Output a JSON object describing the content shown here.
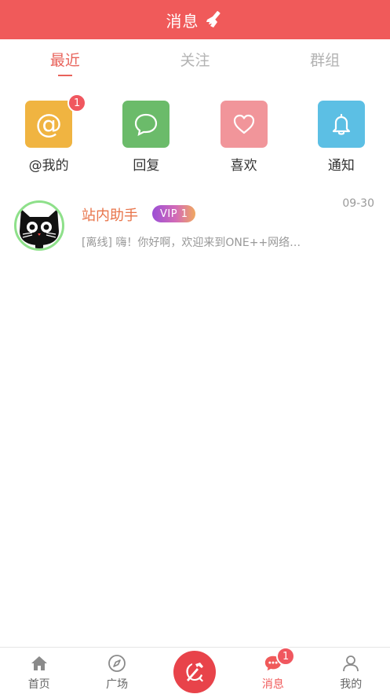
{
  "header": {
    "title": "消息",
    "icon": "broom-icon"
  },
  "tabs": [
    {
      "label": "最近",
      "active": true
    },
    {
      "label": "关注",
      "active": false
    },
    {
      "label": "群组",
      "active": false
    }
  ],
  "quick": [
    {
      "label": "@我的",
      "icon": "at-icon",
      "color": "#f0b441",
      "badge": "1"
    },
    {
      "label": "回复",
      "icon": "chat-bubble-icon",
      "color": "#6bbb6a"
    },
    {
      "label": "喜欢",
      "icon": "heart-icon",
      "color": "#f1959a"
    },
    {
      "label": "通知",
      "icon": "bell-icon",
      "color": "#5cbfe4"
    }
  ],
  "message": {
    "name": "站内助手",
    "vip": "VIP 1",
    "time": "09-30",
    "preview": "[离线] 嗨！你好啊，欢迎来到ONE++网络…",
    "avatar_icon": "cat-avatar-icon"
  },
  "bottom_nav": [
    {
      "label": "首页",
      "icon": "home-icon"
    },
    {
      "label": "广场",
      "icon": "compass-icon"
    },
    {
      "label": "",
      "icon": "hammer-sickle-icon",
      "center": true
    },
    {
      "label": "消息",
      "icon": "message-icon",
      "active": true,
      "badge": "1"
    },
    {
      "label": "我的",
      "icon": "user-icon"
    }
  ],
  "colors": {
    "accent": "#f05a5a",
    "tab_active": "#e8625a",
    "name": "#e8744a"
  }
}
